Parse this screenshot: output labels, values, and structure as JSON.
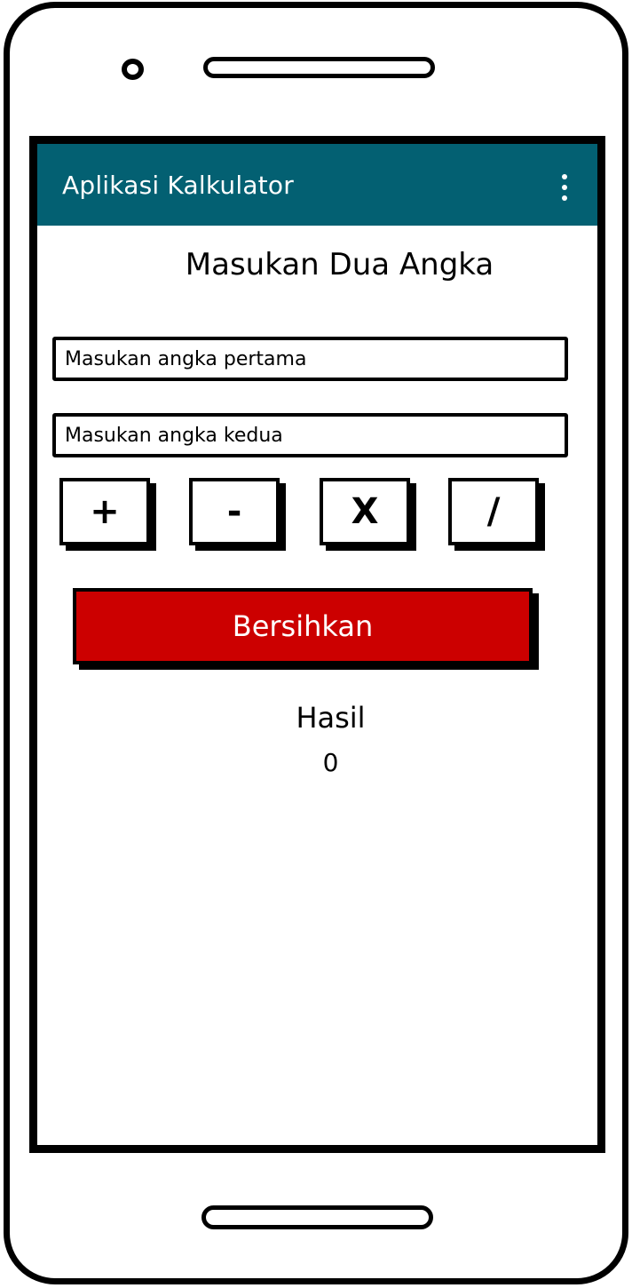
{
  "app_bar": {
    "title": "Aplikasi Kalkulator",
    "background_color": "#036072",
    "menu_icon": "more-vert-icon"
  },
  "main": {
    "heading": "Masukan Dua Angka",
    "first_number": {
      "placeholder": "Masukan angka pertama",
      "value": ""
    },
    "second_number": {
      "placeholder": "Masukan angka kedua",
      "value": ""
    },
    "operations": {
      "add": "+",
      "subtract": "-",
      "multiply": "X",
      "divide": "/"
    },
    "clear_button": {
      "label": "Bersihkan",
      "color": "#cc0000"
    },
    "result": {
      "label": "Hasil",
      "value": "0"
    }
  }
}
